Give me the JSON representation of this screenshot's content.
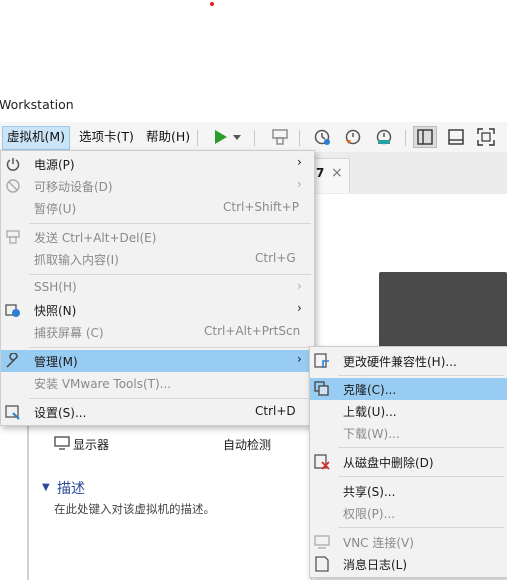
{
  "window_title": "Workstation",
  "menubar": {
    "items": [
      {
        "label": "虚拟机(M)",
        "active": true
      },
      {
        "label": "选项卡(T)",
        "active": false
      },
      {
        "label": "帮助(H)",
        "active": false
      }
    ]
  },
  "toolbar": {
    "icons": [
      "play-icon",
      "dropdown-arrow-icon",
      "send-keys-icon",
      "snapshot-icon",
      "revert-snapshot-icon",
      "snapshot-manager-icon",
      "sidebar-toggle-icon",
      "console-view-icon",
      "fullscreen-icon"
    ],
    "accent": "#2a9d2a"
  },
  "tab": {
    "label_fragment": "7",
    "close": "×"
  },
  "vm_menu": {
    "items": [
      {
        "label": "电源(P)",
        "shortcut": "",
        "arrow": true,
        "disabled": false,
        "icon": "power-icon"
      },
      {
        "label": "可移动设备(D)",
        "shortcut": "",
        "arrow": true,
        "disabled": true,
        "icon": "removable-device-icon"
      },
      {
        "label": "暂停(U)",
        "shortcut": "Ctrl+Shift+P",
        "arrow": false,
        "disabled": true,
        "icon": ""
      },
      {
        "label": "发送 Ctrl+Alt+Del(E)",
        "shortcut": "",
        "arrow": false,
        "disabled": true,
        "icon": "send-keys-icon"
      },
      {
        "label": "抓取输入内容(I)",
        "shortcut": "Ctrl+G",
        "arrow": false,
        "disabled": true,
        "icon": ""
      },
      {
        "label": "SSH(H)",
        "shortcut": "",
        "arrow": true,
        "disabled": true,
        "icon": ""
      },
      {
        "label": "快照(N)",
        "shortcut": "",
        "arrow": true,
        "disabled": false,
        "icon": "snapshot-icon"
      },
      {
        "label": "捕获屏幕 (C)",
        "shortcut": "Ctrl+Alt+PrtScn",
        "arrow": false,
        "disabled": true,
        "icon": ""
      },
      {
        "label": "管理(M)",
        "shortcut": "",
        "arrow": true,
        "disabled": false,
        "icon": "wrench-icon"
      },
      {
        "label": "安装 VMware Tools(T)...",
        "shortcut": "",
        "arrow": false,
        "disabled": true,
        "icon": ""
      },
      {
        "label": "设置(S)...",
        "shortcut": "Ctrl+D",
        "arrow": false,
        "disabled": false,
        "icon": "settings-icon"
      }
    ]
  },
  "manage_submenu": {
    "items": [
      {
        "label": "更改硬件兼容性(H)...",
        "disabled": false,
        "icon": "hardware-compat-icon"
      },
      {
        "label": "克隆(C)...",
        "disabled": false,
        "icon": "clone-icon"
      },
      {
        "label": "上载(U)...",
        "disabled": false,
        "icon": ""
      },
      {
        "label": "下载(W)...",
        "disabled": true,
        "icon": ""
      },
      {
        "label": "从磁盘中删除(D)",
        "disabled": false,
        "icon": "delete-from-disk-icon"
      },
      {
        "label": "共享(S)...",
        "disabled": false,
        "icon": ""
      },
      {
        "label": "权限(P)...",
        "disabled": true,
        "icon": ""
      },
      {
        "label": "VNC 连接(V)",
        "disabled": true,
        "icon": "vnc-icon"
      },
      {
        "label": "消息日志(L)",
        "disabled": false,
        "icon": "message-log-icon"
      }
    ]
  },
  "background": {
    "display_label": "显示器",
    "display_value": "自动检测",
    "description_heading": "描述",
    "description_placeholder": "在此处键入对该虚拟机的描述。"
  },
  "colors": {
    "highlight": "#99ccf3",
    "menu_bg": "#f2f2f2",
    "heading_blue": "#2b4a9a"
  }
}
